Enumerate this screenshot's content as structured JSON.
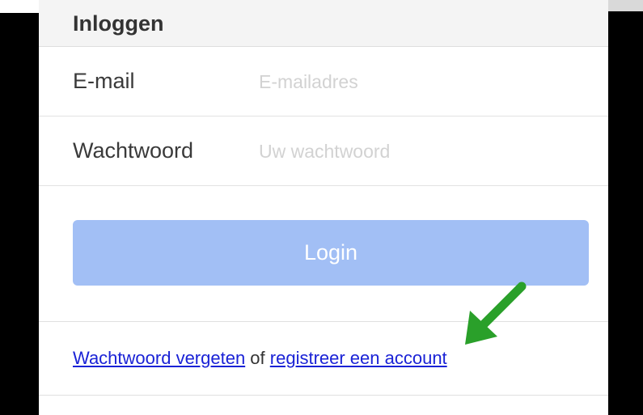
{
  "header": {
    "title": "Inloggen"
  },
  "form": {
    "email_label": "E-mail",
    "email_placeholder": "E-mailadres",
    "email_value": "",
    "password_label": "Wachtwoord",
    "password_placeholder": "Uw wachtwoord",
    "password_value": "",
    "login_label": "Login"
  },
  "links": {
    "forgot_label": "Wachtwoord vergeten",
    "separator": " of ",
    "register_label": "registreer een account"
  },
  "annotation": {
    "arrow_color": "#2aa02a",
    "icon": "arrow-pointer-icon"
  }
}
